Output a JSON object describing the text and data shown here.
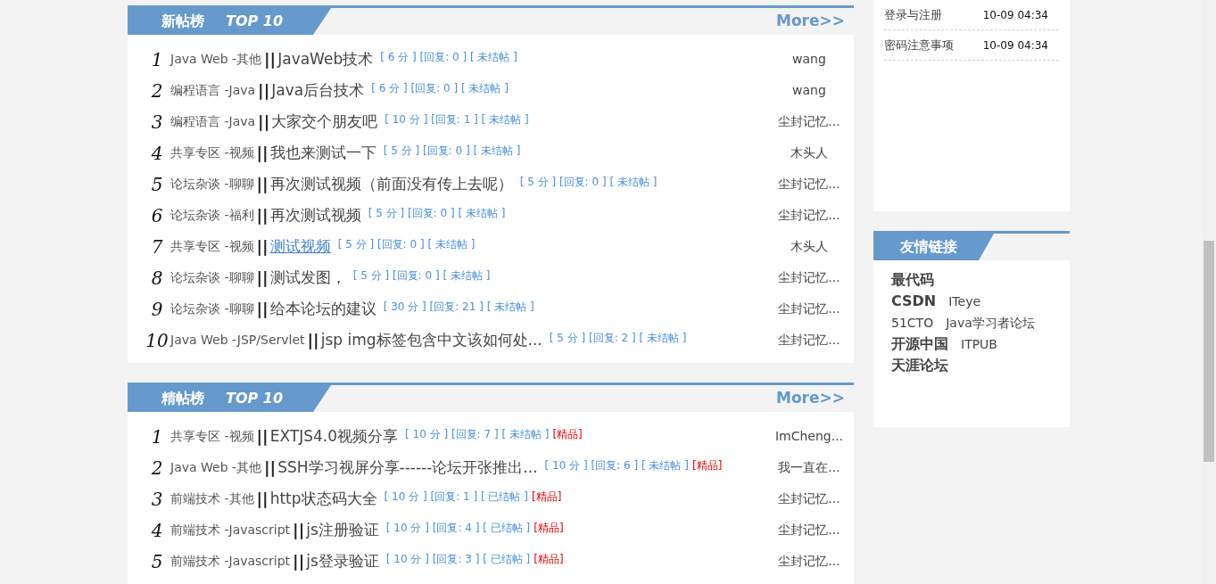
{
  "boards": [
    {
      "title": "新帖榜",
      "subtitle": "TOP 10",
      "more": "More>>",
      "posts": [
        {
          "rank": "1",
          "category": "Java Web -其他",
          "separator": "||",
          "title": "JavaWeb技术",
          "highlighted": false,
          "score": "[ 6 分 ]",
          "replies": "[回复: 0 ]",
          "status": "[ 未结帖 ]",
          "author": "wang"
        },
        {
          "rank": "2",
          "category": "编程语言 -Java",
          "separator": "||",
          "title": "Java后台技术",
          "highlighted": false,
          "score": "[ 6 分 ]",
          "replies": "[回复: 0 ]",
          "status": "[ 未结帖 ]",
          "author": "wang"
        },
        {
          "rank": "3",
          "category": "编程语言 -Java",
          "separator": "||",
          "title": "大家交个朋友吧",
          "highlighted": false,
          "score": "[ 10 分 ]",
          "replies": "[回复: 1 ]",
          "status": "[ 未结帖 ]",
          "author": "尘封记忆..."
        },
        {
          "rank": "4",
          "category": "共享专区 -视频",
          "separator": "||",
          "title": "我也来测试一下",
          "highlighted": false,
          "score": "[ 5 分 ]",
          "replies": "[回复: 0 ]",
          "status": "[ 未结帖 ]",
          "author": "木头人"
        },
        {
          "rank": "5",
          "category": "论坛杂谈 -聊聊",
          "separator": "||",
          "title": "再次测试视频（前面没有传上去呢）",
          "highlighted": false,
          "score": "[ 5 分 ]",
          "replies": "[回复: 0 ]",
          "status": "[ 未结帖 ]",
          "author": "尘封记忆..."
        },
        {
          "rank": "6",
          "category": "论坛杂谈 -福利",
          "separator": "||",
          "title": "再次测试视频",
          "highlighted": false,
          "score": "[ 5 分 ]",
          "replies": "[回复: 0 ]",
          "status": "[ 未结帖 ]",
          "author": "尘封记忆..."
        },
        {
          "rank": "7",
          "category": "共享专区 -视频",
          "separator": "||",
          "title": "测试视频",
          "highlighted": true,
          "score": "[ 5 分 ]",
          "replies": "[回复: 0 ]",
          "status": "[ 未结帖 ]",
          "author": "木头人"
        },
        {
          "rank": "8",
          "category": "论坛杂谈 -聊聊",
          "separator": "||",
          "title": "测试发图，",
          "highlighted": false,
          "score": "[ 5 分 ]",
          "replies": "[回复: 0 ]",
          "status": "[ 未结帖 ]",
          "author": "尘封记忆..."
        },
        {
          "rank": "9",
          "category": "论坛杂谈 -聊聊",
          "separator": "||",
          "title": "给本论坛的建议",
          "highlighted": false,
          "score": "[ 30 分 ]",
          "replies": "[回复: 21 ]",
          "status": "[ 未结帖 ]",
          "author": "尘封记忆..."
        },
        {
          "rank": "10",
          "category": "Java Web -JSP/Servlet",
          "separator": "||",
          "title": "jsp img标签包含中文该如何处...",
          "highlighted": false,
          "score": "[ 5 分 ]",
          "replies": "[回复: 2 ]",
          "status": "[ 未结帖 ]",
          "author": "尘封记忆..."
        }
      ]
    },
    {
      "title": "精帖榜",
      "subtitle": "TOP 10",
      "more": "More>>",
      "posts": [
        {
          "rank": "1",
          "category": "共享专区 -视频",
          "separator": "||",
          "title": "EXTJS4.0视频分享",
          "highlighted": false,
          "score": "[ 10 分 ]",
          "replies": "[回复: 7 ]",
          "status": "[ 未结帖 ]",
          "tag": "[精品]",
          "author": "ImCheng..."
        },
        {
          "rank": "2",
          "category": "Java Web -其他",
          "separator": "||",
          "title": "SSH学习视屏分享------论坛开张推出...",
          "highlighted": false,
          "score": "[ 10 分 ]",
          "replies": "[回复: 6 ]",
          "status": "[ 未结帖 ]",
          "tag": "[精品]",
          "author": "我一直在..."
        },
        {
          "rank": "3",
          "category": "前端技术 -其他",
          "separator": "||",
          "title": "http状态码大全",
          "highlighted": false,
          "score": "[ 10 分 ]",
          "replies": "[回复: 1 ]",
          "status": "[ 已结帖 ]",
          "tag": "[精品]",
          "author": "尘封记忆..."
        },
        {
          "rank": "4",
          "category": "前端技术 -Javascript",
          "separator": "||",
          "title": "js注册验证",
          "highlighted": false,
          "score": "[ 10 分 ]",
          "replies": "[回复: 4 ]",
          "status": "[ 已结帖 ]",
          "tag": "[精品]",
          "author": "尘封记忆..."
        },
        {
          "rank": "5",
          "category": "前端技术 -Javascript",
          "separator": "||",
          "title": "js登录验证",
          "highlighted": false,
          "score": "[ 10 分 ]",
          "replies": "[回复: 3 ]",
          "status": "[ 已结帖 ]",
          "tag": "[精品]",
          "author": "尘封记忆..."
        }
      ]
    }
  ],
  "notices": [
    {
      "title": "登录与注册",
      "time": "10-09 04:34"
    },
    {
      "title": "密码注意事项",
      "time": "10-09 04:34"
    }
  ],
  "friend_links": {
    "title": "友情链接",
    "rows": [
      {
        "links": [
          {
            "text": "最代码",
            "bold": true
          }
        ]
      },
      {
        "links": [
          {
            "text": "CSDN",
            "bold": true
          },
          {
            "text": "ITeye",
            "bold": false
          }
        ]
      },
      {
        "links": [
          {
            "text": "51CTO",
            "bold": false
          },
          {
            "text": "Java学习者论坛",
            "bold": false
          }
        ]
      },
      {
        "links": [
          {
            "text": "开源中国",
            "bold": true
          },
          {
            "text": "ITPUB",
            "bold": false
          }
        ]
      },
      {
        "links": [
          {
            "text": "天涯论坛",
            "bold": true
          }
        ]
      }
    ]
  }
}
